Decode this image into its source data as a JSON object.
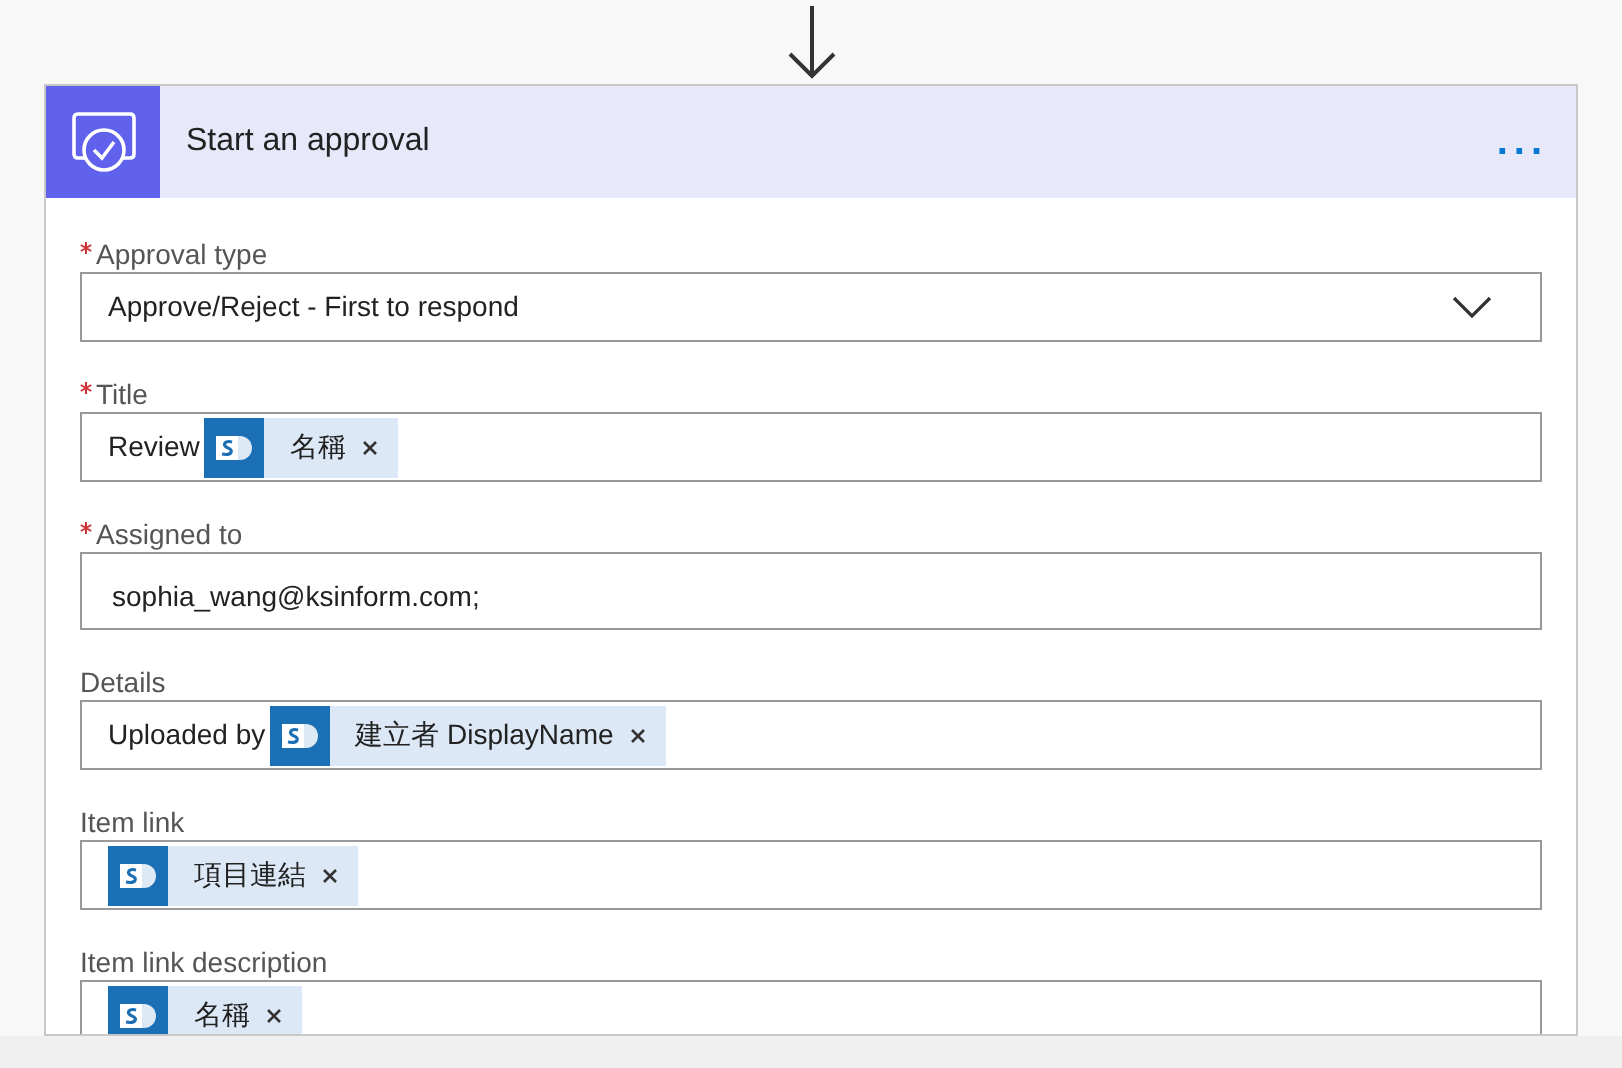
{
  "card": {
    "title": "Start an approval",
    "menu": "..."
  },
  "fields": [
    {
      "label": "Approval type",
      "required": true,
      "kind": "dropdown",
      "parts": [
        {
          "kind": "text",
          "text": "Approve/Reject - First to respond"
        }
      ]
    },
    {
      "label": "Title",
      "required": true,
      "kind": "tokens",
      "parts": [
        {
          "kind": "text",
          "text": "Review"
        },
        {
          "kind": "token",
          "text": "名稱"
        }
      ]
    },
    {
      "label": "Assigned to",
      "required": true,
      "kind": "tokens",
      "parts": [
        {
          "kind": "text",
          "text": "sophia_wang@ksinform.com;"
        }
      ]
    },
    {
      "label": "Details",
      "required": false,
      "kind": "tokens",
      "parts": [
        {
          "kind": "text",
          "text": "Uploaded by"
        },
        {
          "kind": "token",
          "text": "建立者 DisplayName"
        }
      ]
    },
    {
      "label": "Item link",
      "required": false,
      "kind": "tokens",
      "parts": [
        {
          "kind": "token",
          "text": "項目連結"
        }
      ]
    },
    {
      "label": "Item link description",
      "required": false,
      "kind": "tokens",
      "parts": [
        {
          "kind": "token",
          "text": "名稱"
        }
      ]
    }
  ]
}
